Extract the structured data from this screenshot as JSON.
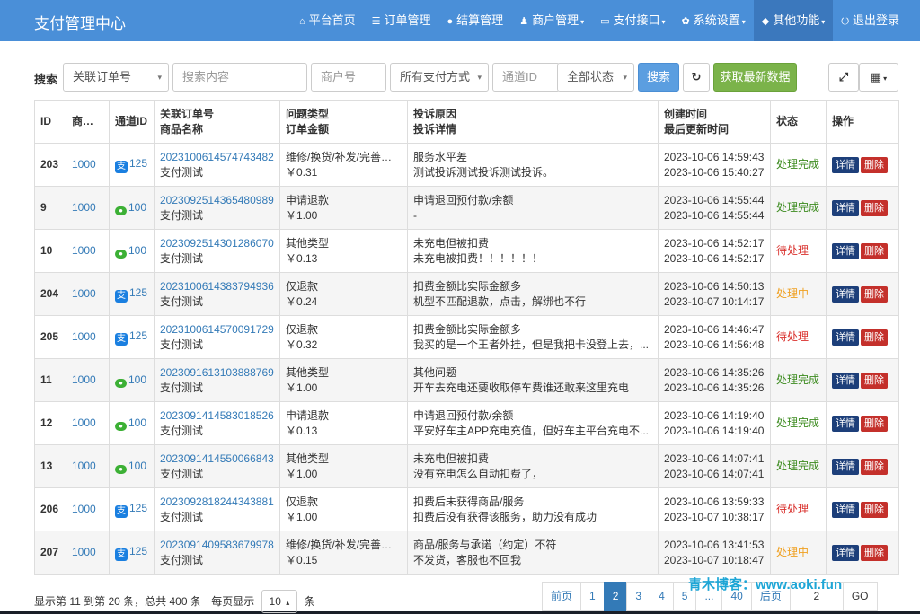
{
  "brand": "支付管理中心",
  "nav": [
    {
      "icon": "home-icon",
      "glyph": "⌂",
      "label": "平台首页",
      "caret": false,
      "active": false
    },
    {
      "icon": "list-icon",
      "glyph": "☰",
      "label": "订单管理",
      "caret": false,
      "active": false
    },
    {
      "icon": "coin-icon",
      "glyph": "●",
      "label": "结算管理",
      "caret": false,
      "active": false
    },
    {
      "icon": "user-icon",
      "glyph": "♟",
      "label": "商户管理",
      "caret": true,
      "active": false
    },
    {
      "icon": "card-icon",
      "glyph": "▭",
      "label": "支付接口",
      "caret": true,
      "active": false
    },
    {
      "icon": "gear-icon",
      "glyph": "✿",
      "label": "系统设置",
      "caret": true,
      "active": false
    },
    {
      "icon": "cube-icon",
      "glyph": "◆",
      "label": "其他功能",
      "caret": true,
      "active": true
    },
    {
      "icon": "power-icon",
      "glyph": "⏻",
      "label": "退出登录",
      "caret": false,
      "active": false
    }
  ],
  "search": {
    "label": "搜索",
    "field_select": "关联订单号",
    "content_placeholder": "搜索内容",
    "merchant_placeholder": "商户号",
    "paytype_select": "所有支付方式",
    "channel_placeholder": "通道ID",
    "status_select": "全部状态",
    "search_button": "搜索",
    "refresh_icon": "refresh-icon",
    "fetch_button": "获取最新数据",
    "fullscreen_icon": "expand-icon",
    "columns_icon": "grid-icon"
  },
  "table": {
    "headers": [
      [
        "ID",
        ""
      ],
      [
        "商户号",
        ""
      ],
      [
        "通道ID",
        ""
      ],
      [
        "关联订单号",
        "商品名称"
      ],
      [
        "问题类型",
        "订单金额"
      ],
      [
        "投诉原因",
        "投诉详情"
      ],
      [
        "创建时间",
        "最后更新时间"
      ],
      [
        "状态",
        ""
      ],
      [
        "操作",
        ""
      ]
    ],
    "rows": [
      {
        "id": "203",
        "merchant": "1000",
        "channel_icon": "alipay",
        "channel": "125",
        "order": "2023100614574743482",
        "product": "支付测试",
        "type": "维修/换货/补发/完善服务",
        "amount": "￥0.31",
        "reason": "服务水平差",
        "detail": "测试投诉测试投诉测试投诉。",
        "created": "2023-10-06 14:59:43",
        "updated": "2023-10-06 15:40:27",
        "status": "处理完成",
        "status_color": "#3c8b1f"
      },
      {
        "id": "9",
        "merchant": "1000",
        "channel_icon": "wechat",
        "channel": "100",
        "order": "2023092514365480989",
        "product": "支付测试",
        "type": "申请退款",
        "amount": "￥1.00",
        "reason": "申请退回预付款/余额",
        "detail": "-",
        "created": "2023-10-06 14:55:44",
        "updated": "2023-10-06 14:55:44",
        "status": "处理完成",
        "status_color": "#3c8b1f"
      },
      {
        "id": "10",
        "merchant": "1000",
        "channel_icon": "wechat",
        "channel": "100",
        "order": "2023092514301286070",
        "product": "支付测试",
        "type": "其他类型",
        "amount": "￥0.13",
        "reason": "未充电但被扣费",
        "detail": "未充电被扣费！！！！！！",
        "created": "2023-10-06 14:52:17",
        "updated": "2023-10-06 14:52:17",
        "status": "待处理",
        "status_color": "#d9302c"
      },
      {
        "id": "204",
        "merchant": "1000",
        "channel_icon": "alipay",
        "channel": "125",
        "order": "2023100614383794936",
        "product": "支付测试",
        "type": "仅退款",
        "amount": "￥0.24",
        "reason": "扣费金额比实际金额多",
        "detail": "机型不匹配退款，点击，解绑也不行",
        "created": "2023-10-06 14:50:13",
        "updated": "2023-10-07 10:14:17",
        "status": "处理中",
        "status_color": "#f0a020"
      },
      {
        "id": "205",
        "merchant": "1000",
        "channel_icon": "alipay",
        "channel": "125",
        "order": "2023100614570091729",
        "product": "支付测试",
        "type": "仅退款",
        "amount": "￥0.32",
        "reason": "扣费金额比实际金额多",
        "detail": "我买的是一个王者外挂，但是我把卡没登上去，...",
        "created": "2023-10-06 14:46:47",
        "updated": "2023-10-06 14:56:48",
        "status": "待处理",
        "status_color": "#d9302c"
      },
      {
        "id": "11",
        "merchant": "1000",
        "channel_icon": "wechat",
        "channel": "100",
        "order": "2023091613103888769",
        "product": "支付测试",
        "type": "其他类型",
        "amount": "￥1.00",
        "reason": "其他问题",
        "detail": "开车去充电还要收取停车费谁还敢来这里充电",
        "created": "2023-10-06 14:35:26",
        "updated": "2023-10-06 14:35:26",
        "status": "处理完成",
        "status_color": "#3c8b1f"
      },
      {
        "id": "12",
        "merchant": "1000",
        "channel_icon": "wechat",
        "channel": "100",
        "order": "2023091414583018526",
        "product": "支付测试",
        "type": "申请退款",
        "amount": "￥0.13",
        "reason": "申请退回预付款/余额",
        "detail": "平安好车主APP充电充值，但好车主平台充电不...",
        "created": "2023-10-06 14:19:40",
        "updated": "2023-10-06 14:19:40",
        "status": "处理完成",
        "status_color": "#3c8b1f"
      },
      {
        "id": "13",
        "merchant": "1000",
        "channel_icon": "wechat",
        "channel": "100",
        "order": "2023091414550066843",
        "product": "支付测试",
        "type": "其他类型",
        "amount": "￥1.00",
        "reason": "未充电但被扣费",
        "detail": "没有充电怎么自动扣费了，",
        "created": "2023-10-06 14:07:41",
        "updated": "2023-10-06 14:07:41",
        "status": "处理完成",
        "status_color": "#3c8b1f"
      },
      {
        "id": "206",
        "merchant": "1000",
        "channel_icon": "alipay",
        "channel": "125",
        "order": "2023092818244343881",
        "product": "支付测试",
        "type": "仅退款",
        "amount": "￥1.00",
        "reason": "扣费后未获得商品/服务",
        "detail": "扣费后没有获得该服务，助力没有成功",
        "created": "2023-10-06 13:59:33",
        "updated": "2023-10-07 10:38:17",
        "status": "待处理",
        "status_color": "#d9302c"
      },
      {
        "id": "207",
        "merchant": "1000",
        "channel_icon": "alipay",
        "channel": "125",
        "order": "2023091409583679978",
        "product": "支付测试",
        "type": "维修/换货/补发/完善服务",
        "amount": "￥0.15",
        "reason": "商品/服务与承诺（约定）不符",
        "detail": "不发货，客服也不回我",
        "created": "2023-10-06 13:41:53",
        "updated": "2023-10-07 10:18:47",
        "status": "处理中",
        "status_color": "#f0a020"
      }
    ],
    "action_detail": "详情",
    "action_delete": "删除"
  },
  "footer": {
    "info": "显示第 11 到第 20 条，总共 400 条",
    "per_page_prefix": "每页显示",
    "per_page": "10",
    "per_page_suffix": "条"
  },
  "pager": {
    "prev": "前页",
    "pages": [
      "1",
      "2",
      "3",
      "4",
      "5",
      "...",
      "40"
    ],
    "active": "2",
    "next": "后页",
    "input": "2",
    "go": "GO"
  },
  "watermark": "青木博客：www.aoki.fun"
}
